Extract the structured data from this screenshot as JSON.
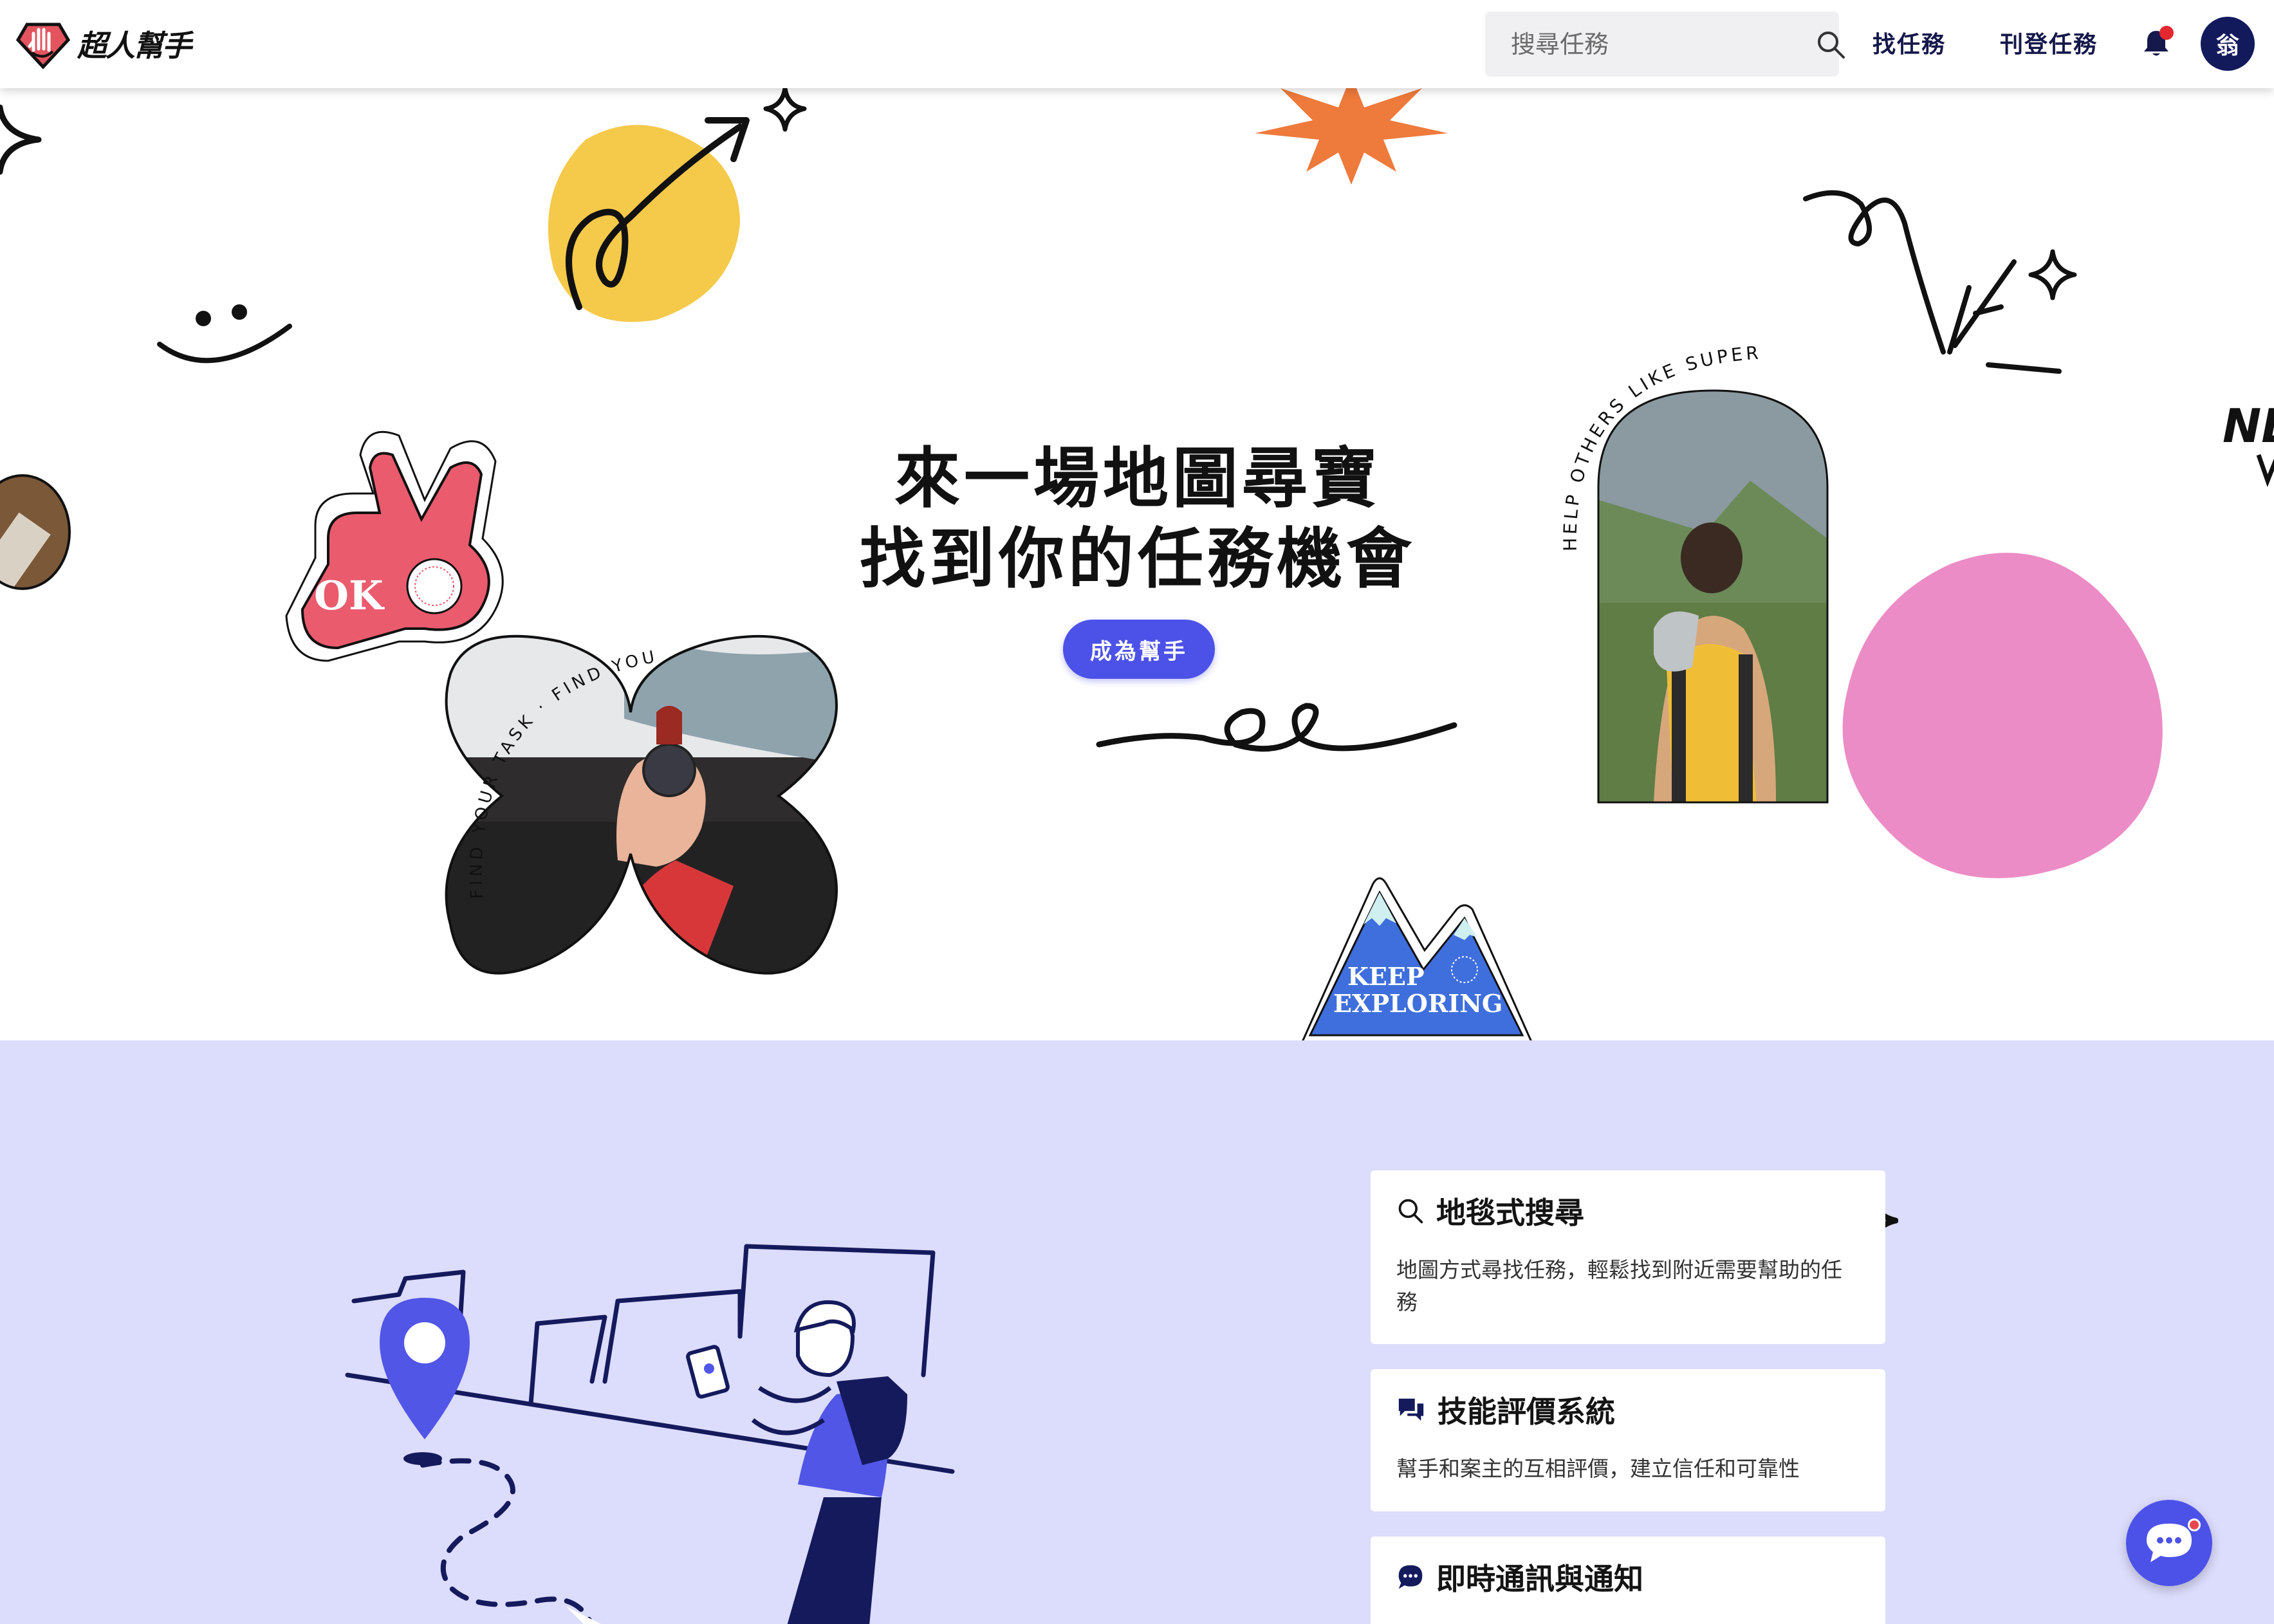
{
  "header": {
    "logo_text": "超人幫手",
    "search": {
      "placeholder": "搜尋任務",
      "value": ""
    },
    "nav": {
      "find_tasks": "找任務",
      "post_task": "刊登任務"
    },
    "avatar_initial": "翁",
    "colors": {
      "nav_text": "#14184a",
      "avatar_bg": "#121a5c",
      "notification_dot": "#e4282f"
    }
  },
  "hero": {
    "title_line1": "來一場地圖尋寶",
    "title_line2": "找到你的任務機會",
    "cta_label": "成為幫手",
    "sticker_ok": "OK",
    "curved_text_left": "FIND YOUR TASK · FIND YOU TASKS NOW",
    "curved_text_right": "HELP OTHERS LIKE SUPERMAN",
    "badge_line1": "KEEP",
    "badge_line2": "EXPLORING",
    "edge_text": "NE",
    "colors": {
      "cta_bg": "#4c52e8",
      "yellow_blob": "#f5c94a",
      "pink_blob": "#ec8cc6",
      "orange_burst": "#ee7a3c",
      "ok_red": "#ea5b6e",
      "badge_blue": "#3f6fdc"
    }
  },
  "features": {
    "background": "#dcdcfc",
    "cards": [
      {
        "icon": "search-icon",
        "title": "地毯式搜尋",
        "desc": "地圖方式尋找任務，輕鬆找到附近需要幫助的任務"
      },
      {
        "icon": "review-chat-icon",
        "title": "技能評價系統",
        "desc": "幫手和案主的互相評價，建立信任和可靠性"
      },
      {
        "icon": "message-icon",
        "title": "即時通訊與通知",
        "desc": ""
      }
    ]
  },
  "chat_fab": {
    "icon": "chat-bubble-icon",
    "color": "#4c52e8"
  }
}
